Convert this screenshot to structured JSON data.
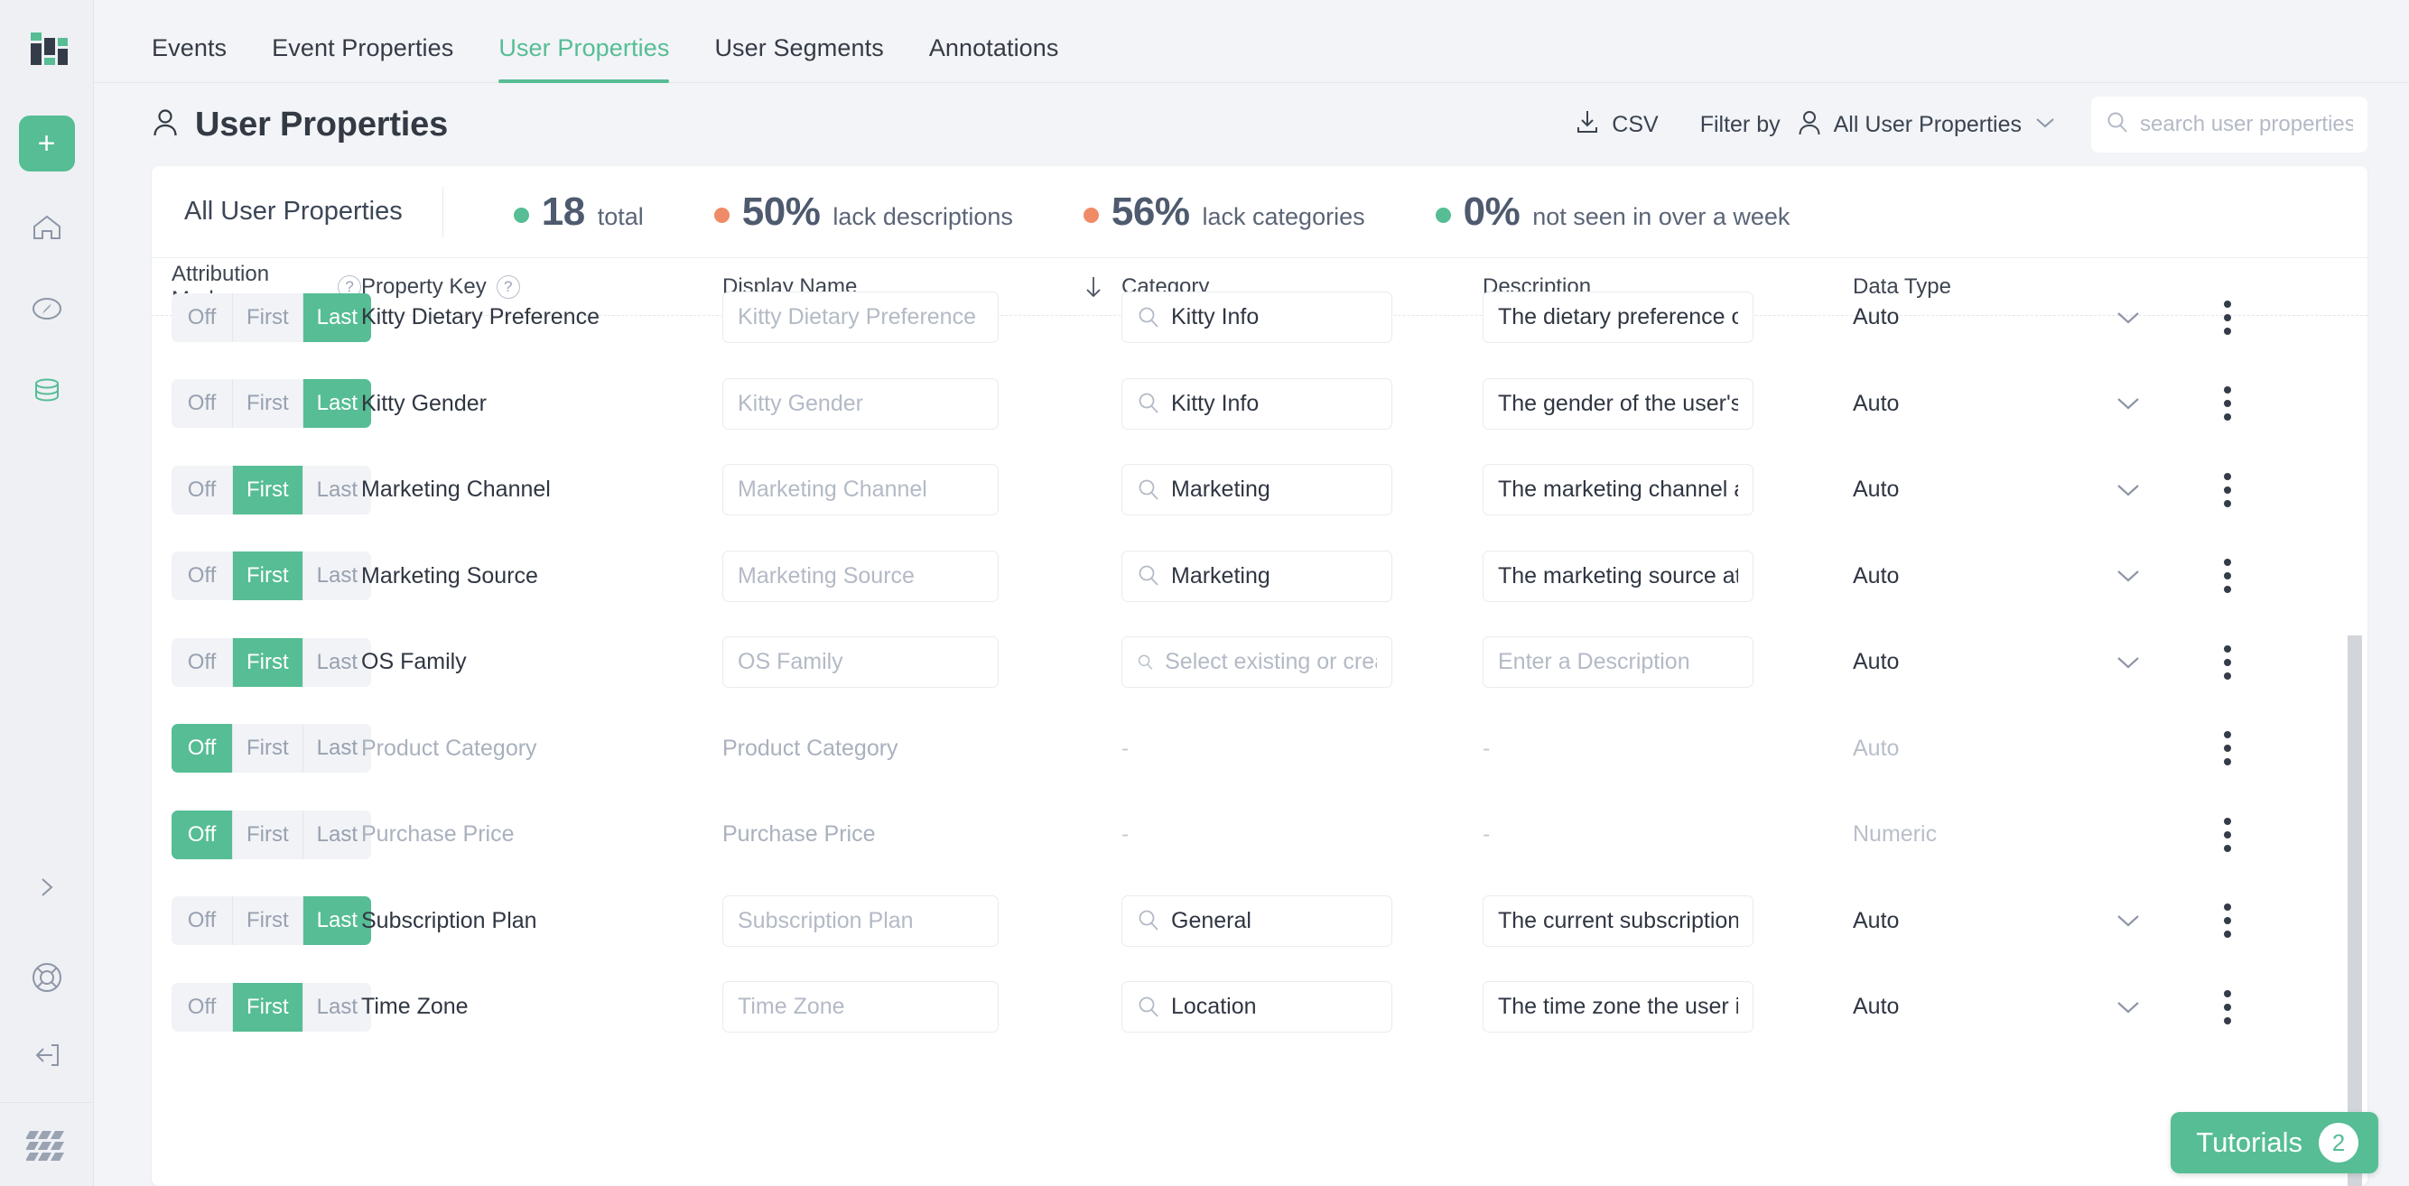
{
  "brand": {
    "accent": "#56bd94",
    "warn": "#ef8b67",
    "dark": "#333a44"
  },
  "rail": {
    "logo": "mixpanel-logo",
    "add_label": "+",
    "items": [
      {
        "name": "home-icon"
      },
      {
        "name": "compass-icon"
      },
      {
        "name": "database-icon"
      },
      {
        "name": "chevron-right-icon"
      },
      {
        "name": "lifebuoy-icon"
      },
      {
        "name": "logout-icon"
      }
    ],
    "footer_icon": "grid-pattern-icon"
  },
  "tabs": [
    {
      "label": "Events",
      "active": false
    },
    {
      "label": "Event Properties",
      "active": false
    },
    {
      "label": "User Properties",
      "active": true
    },
    {
      "label": "User Segments",
      "active": false
    },
    {
      "label": "Annotations",
      "active": false
    }
  ],
  "header": {
    "title": "User Properties",
    "title_icon": "user-icon",
    "csv_label": "CSV",
    "csv_icon": "download-icon",
    "filter_by_label": "Filter by",
    "filter_icon": "user-icon",
    "filter_value": "All User Properties",
    "filter_chevron": "chevron-down-icon",
    "search_icon": "search-icon",
    "search_value": "",
    "search_placeholder": "search user properties"
  },
  "stats": {
    "group_label": "All User Properties",
    "items": [
      {
        "value": "18",
        "label": "total",
        "dot": "#56bd94"
      },
      {
        "value": "50%",
        "label": "lack descriptions",
        "dot": "#ef8b67"
      },
      {
        "value": "56%",
        "label": "lack categories",
        "dot": "#ef8b67"
      },
      {
        "value": "0%",
        "label": "not seen in over a week",
        "dot": "#56bd94"
      }
    ]
  },
  "table": {
    "columns": [
      {
        "key": "attribution_mode",
        "label": "Attribution Mode",
        "help": "?"
      },
      {
        "key": "property_key",
        "label": "Property Key",
        "help": "?"
      },
      {
        "key": "display_name",
        "label": "Display Name",
        "help": ""
      },
      {
        "key": "category",
        "label": "Category",
        "help": ""
      },
      {
        "key": "description",
        "label": "Description",
        "help": ""
      },
      {
        "key": "data_type",
        "label": "Data Type",
        "help": ""
      }
    ],
    "sort_icon": "arrow-down-icon",
    "attribution_options": [
      "Off",
      "First",
      "Last"
    ],
    "row_menu_icon": "kebab-menu-icon",
    "row_expand_icon": "chevron-down-icon",
    "category_search_icon": "search-icon",
    "placeholders": {
      "category": "Select existing or create new",
      "description": "Enter a Description"
    },
    "rows": [
      {
        "attribution": "Last",
        "property_key": "Kitty Dietary Preference",
        "key_muted": false,
        "display_name": "",
        "display_placeholder": "Kitty Dietary Preference",
        "category": "Kitty Info",
        "category_empty": false,
        "description": "The dietary preference of the user'",
        "description_empty": false,
        "data_type": "Auto",
        "type_muted": false,
        "disabled": false
      },
      {
        "attribution": "Last",
        "property_key": "Kitty Gender",
        "key_muted": false,
        "display_name": "",
        "display_placeholder": "Kitty Gender",
        "category": "Kitty Info",
        "category_empty": false,
        "description": "The gender of the user's cat.",
        "description_empty": false,
        "data_type": "Auto",
        "type_muted": false,
        "disabled": false
      },
      {
        "attribution": "First",
        "property_key": "Marketing Channel",
        "key_muted": false,
        "display_name": "",
        "display_placeholder": "Marketing Channel",
        "category": "Marketing",
        "category_empty": false,
        "description": "The marketing channel attributed ",
        "description_empty": false,
        "data_type": "Auto",
        "type_muted": false,
        "disabled": false
      },
      {
        "attribution": "First",
        "property_key": "Marketing Source",
        "key_muted": false,
        "display_name": "",
        "display_placeholder": "Marketing Source",
        "category": "Marketing",
        "category_empty": false,
        "description": "The marketing source attributed to",
        "description_empty": false,
        "data_type": "Auto",
        "type_muted": false,
        "disabled": false
      },
      {
        "attribution": "First",
        "property_key": "OS Family",
        "key_muted": false,
        "display_name": "",
        "display_placeholder": "OS Family",
        "category": "",
        "category_empty": true,
        "description": "",
        "description_empty": true,
        "data_type": "Auto",
        "type_muted": false,
        "disabled": false
      },
      {
        "attribution": "Off",
        "property_key": "Product Category",
        "key_muted": true,
        "display_name": "Product Category",
        "display_placeholder": "",
        "category": "-",
        "category_empty": false,
        "description": "-",
        "description_empty": false,
        "data_type": "Auto",
        "type_muted": true,
        "disabled": true
      },
      {
        "attribution": "Off",
        "property_key": "Purchase Price",
        "key_muted": true,
        "display_name": "Purchase Price",
        "display_placeholder": "",
        "category": "-",
        "category_empty": false,
        "description": "-",
        "description_empty": false,
        "data_type": "Numeric",
        "type_muted": true,
        "disabled": true
      },
      {
        "attribution": "Last",
        "property_key": "Subscription Plan",
        "key_muted": false,
        "display_name": "",
        "display_placeholder": "Subscription Plan",
        "category": "General",
        "category_empty": false,
        "description": "The current subscription plan of th",
        "description_empty": false,
        "data_type": "Auto",
        "type_muted": false,
        "disabled": false
      },
      {
        "attribution": "First",
        "property_key": "Time Zone",
        "key_muted": false,
        "display_name": "",
        "display_placeholder": "Time Zone",
        "category": "Location",
        "category_empty": false,
        "description": "The time zone the user is located i",
        "description_empty": false,
        "data_type": "Auto",
        "type_muted": false,
        "disabled": false
      }
    ]
  },
  "tutorials": {
    "label": "Tutorials",
    "count": "2"
  }
}
